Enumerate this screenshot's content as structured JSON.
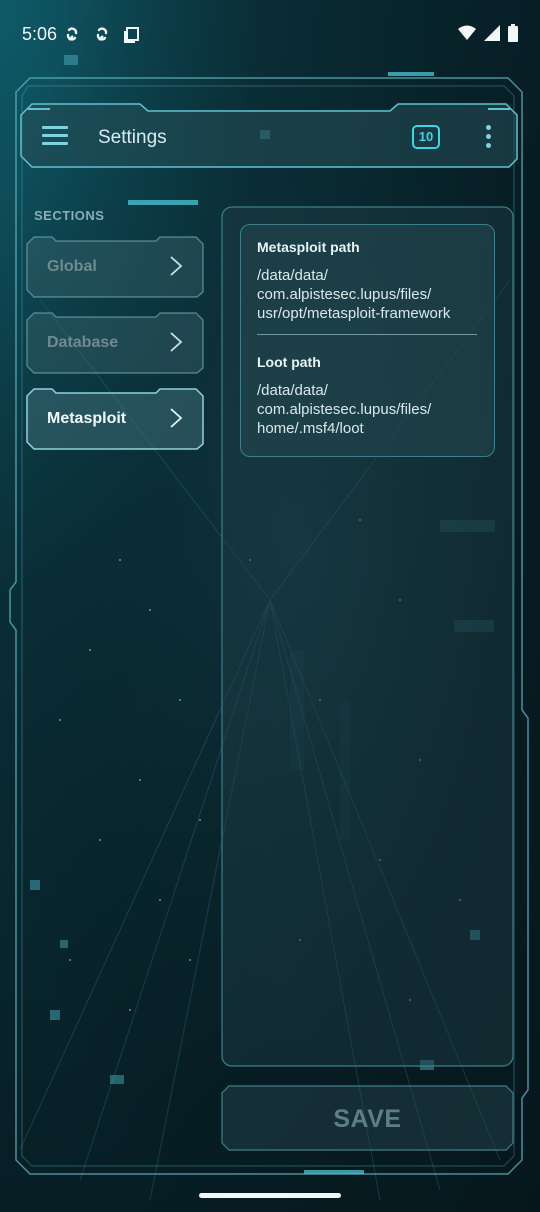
{
  "status_bar": {
    "time": "5:06",
    "icons": [
      "sync-icon",
      "sync-icon",
      "screenshot-icon",
      "wifi-icon",
      "signal-icon",
      "battery-icon"
    ]
  },
  "app_bar": {
    "title": "Settings",
    "badge_count": "10",
    "menu_icon": "hamburger-menu-icon",
    "overflow_icon": "more-vert-icon"
  },
  "sections": {
    "label": "SECTIONS",
    "items": [
      {
        "label": "Global",
        "state": "inactive"
      },
      {
        "label": "Database",
        "state": "inactive"
      },
      {
        "label": "Metasploit",
        "state": "active"
      }
    ]
  },
  "metasploit": {
    "fields": [
      {
        "title": "Metasploit path",
        "value": "/data/data/\ncom.alpistesec.lupus/files/\nusr/opt/metasploit-framework"
      },
      {
        "title": "Loot path",
        "value": "/data/data/\ncom.alpistesec.lupus/files/\nhome/.msf4/loot"
      }
    ]
  },
  "save_button": {
    "label": "SAVE"
  },
  "colors": {
    "accent": "#3fd4e6",
    "frame": "#5fb8c4",
    "background": "#071e25"
  }
}
